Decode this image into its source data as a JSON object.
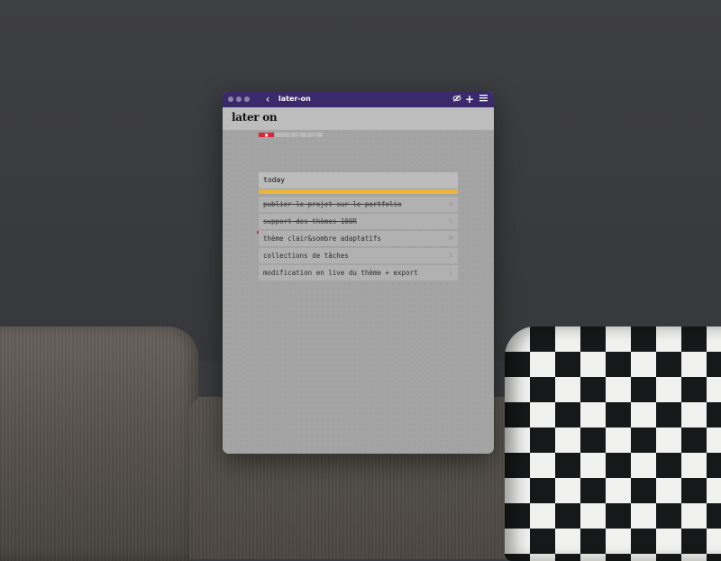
{
  "window": {
    "title": "later-on",
    "back_icon": "‹",
    "icons": [
      "eye-slash-icon",
      "plus-icon",
      "menu-icon"
    ]
  },
  "header": {
    "logo": "later on"
  },
  "pager": {
    "pages": [
      "■",
      "",
      "□",
      "□"
    ],
    "active_index": 0
  },
  "list": {
    "title": "today",
    "progress_color": "#e9b53c",
    "tasks": [
      {
        "text": "publier le projet sur le portfolio",
        "tag": "S",
        "done": true
      },
      {
        "text": "support des thèmes 100R",
        "tag": "L",
        "done": true
      },
      {
        "text": "thème clair&sombre adaptatifs",
        "tag": "M",
        "done": false,
        "marked": true
      },
      {
        "text": "collections de tâches",
        "tag": "S",
        "done": false
      },
      {
        "text": "modification en live du thème + export",
        "tag": "L",
        "done": false
      }
    ]
  },
  "colors": {
    "titlebar": "#3a2a6b",
    "accent": "#d8263b"
  }
}
